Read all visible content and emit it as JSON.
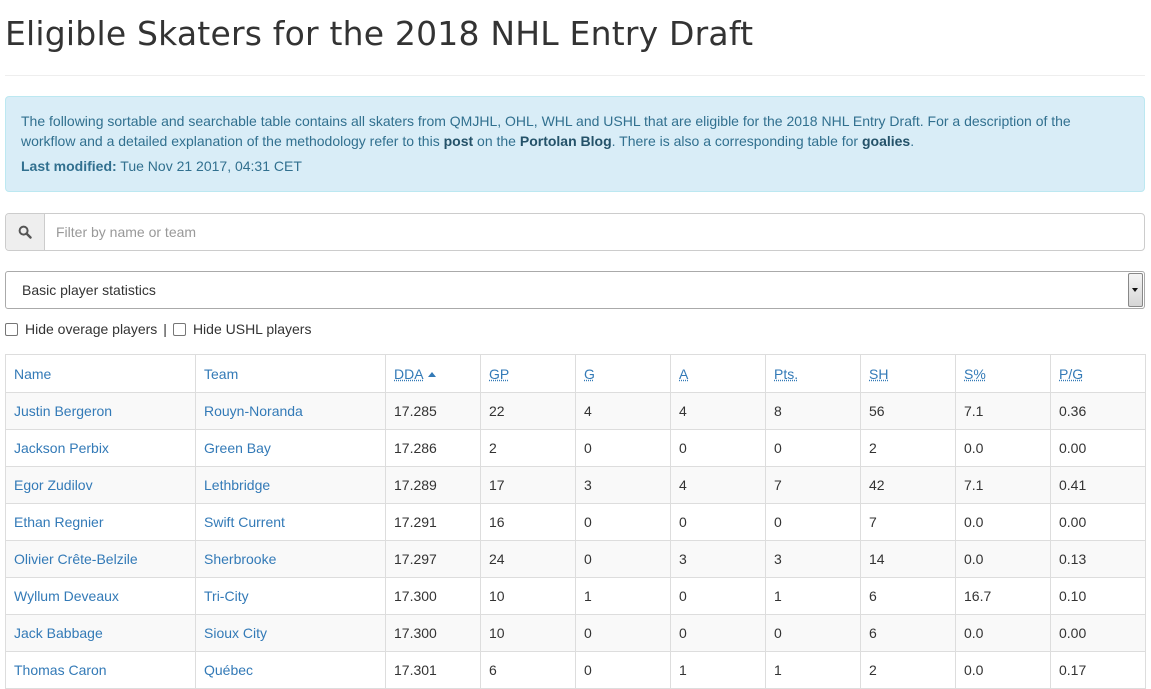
{
  "page": {
    "title": "Eligible Skaters for the 2018 NHL Entry Draft"
  },
  "info": {
    "text_1": "The following sortable and searchable table contains all skaters from QMJHL, OHL, WHL and USHL that are eligible for the 2018 NHL Entry Draft. For a description of the workflow and a detailed explanation of the methodology refer to this ",
    "link_post": "post",
    "text_2": " on the ",
    "link_blog": "Portolan Blog",
    "text_3": ". There is also a corresponding table for ",
    "link_goalies": "goalies",
    "text_4": ".",
    "last_modified_label": "Last modified:",
    "last_modified_value": " Tue Nov 21 2017, 04:31 CET"
  },
  "search": {
    "placeholder": "Filter by name or team",
    "value": "",
    "icon": "search-icon"
  },
  "select": {
    "selected": "Basic player statistics"
  },
  "filters": {
    "hide_overage": "Hide overage players",
    "separator": "|",
    "hide_ushl": "Hide USHL players"
  },
  "table": {
    "sorted_column": "DDA",
    "sort_direction": "ascending",
    "headers": [
      "Name",
      "Team",
      "DDA",
      "GP",
      "G",
      "A",
      "Pts.",
      "SH",
      "S%",
      "P/G"
    ],
    "rows": [
      [
        "Justin Bergeron",
        "Rouyn-Noranda",
        "17.285",
        "22",
        "4",
        "4",
        "8",
        "56",
        "7.1",
        "0.36"
      ],
      [
        "Jackson Perbix",
        "Green Bay",
        "17.286",
        "2",
        "0",
        "0",
        "0",
        "2",
        "0.0",
        "0.00"
      ],
      [
        "Egor Zudilov",
        "Lethbridge",
        "17.289",
        "17",
        "3",
        "4",
        "7",
        "42",
        "7.1",
        "0.41"
      ],
      [
        "Ethan Regnier",
        "Swift Current",
        "17.291",
        "16",
        "0",
        "0",
        "0",
        "7",
        "0.0",
        "0.00"
      ],
      [
        "Olivier Crête-Belzile",
        "Sherbrooke",
        "17.297",
        "24",
        "0",
        "3",
        "3",
        "14",
        "0.0",
        "0.13"
      ],
      [
        "Wyllum Deveaux",
        "Tri-City",
        "17.300",
        "10",
        "1",
        "0",
        "1",
        "6",
        "16.7",
        "0.10"
      ],
      [
        "Jack Babbage",
        "Sioux City",
        "17.300",
        "10",
        "0",
        "0",
        "0",
        "6",
        "0.0",
        "0.00"
      ],
      [
        "Thomas Caron",
        "Québec",
        "17.301",
        "6",
        "0",
        "1",
        "1",
        "2",
        "0.0",
        "0.17"
      ]
    ]
  },
  "colors": {
    "link": "#337ab7",
    "info_bg": "#d9edf7",
    "info_text": "#31708f",
    "info_border": "#bce8f1",
    "row_stripe": "#f9f9f9",
    "border": "#dddddd"
  }
}
